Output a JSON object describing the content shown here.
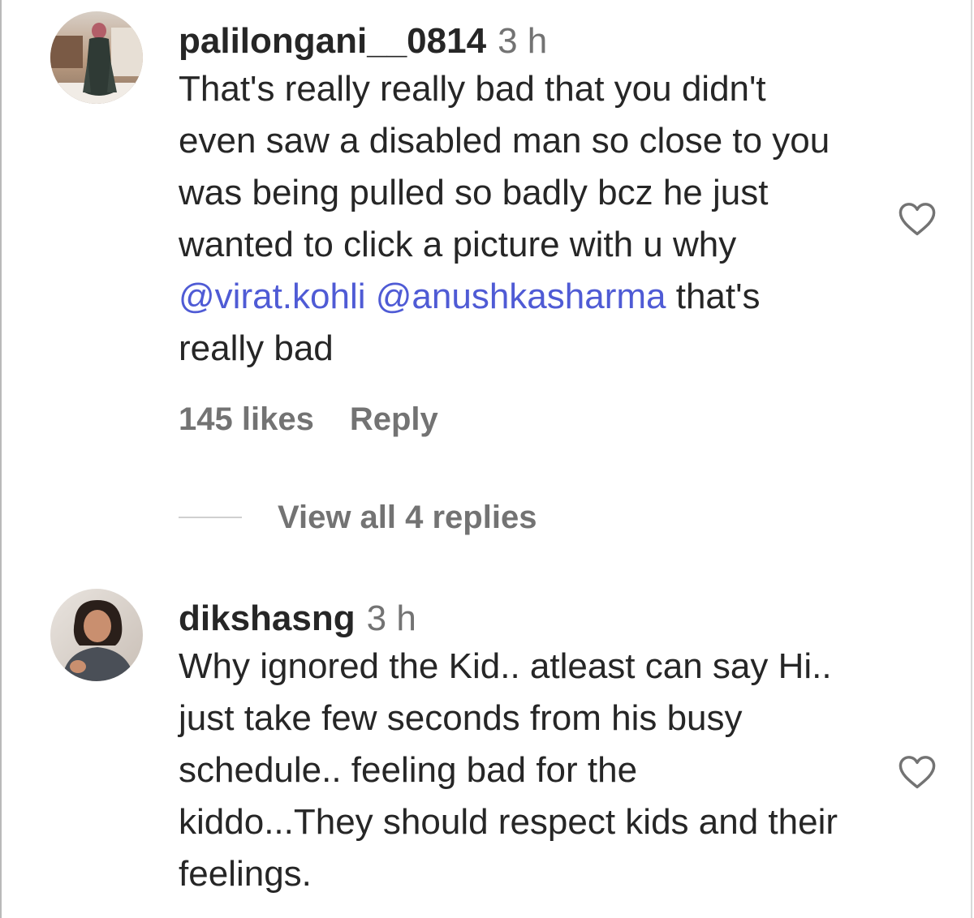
{
  "comments": [
    {
      "username": "palilongani__0814",
      "time": "3 h",
      "text_plain": "That's really really bad that you didn't even saw a disabled man so close to you was being pulled so badly bcz he just wanted to click a picture with u why ",
      "mention1": "@virat.kohli",
      "mention2": "@anushkasharma",
      "text_tail": " that's really bad",
      "likes": "145 likes",
      "reply_label": "Reply",
      "view_replies": "View all 4 replies"
    },
    {
      "username": "dikshasng",
      "time": "3 h",
      "text": "Why ignored the Kid.. atleast can say Hi.. just take few seconds from his busy schedule.. feeling bad for the kiddo...They should respect kids and their feelings."
    }
  ],
  "icons": {
    "like": "heart-icon"
  },
  "colors": {
    "mention": "#4f5bd5",
    "secondary_text": "#737373",
    "primary_text": "#262626"
  }
}
